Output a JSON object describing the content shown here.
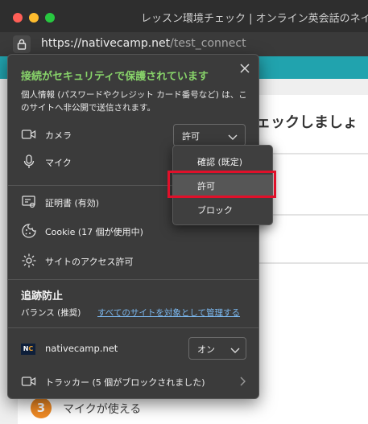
{
  "window": {
    "title": "レッスン環境チェック | オンライン英会話のネイティ"
  },
  "address_bar": {
    "url_host": "https://nativecamp.net",
    "url_path": "/test_connect"
  },
  "page": {
    "heading": "チェックしましょ",
    "step_number": "3",
    "step_text": "マイクが使える"
  },
  "panel": {
    "secure_title": "接続がセキュリティで保護されています",
    "secure_desc": "個人情報 (パスワードやクレジット カード番号など) は、このサイトへ非公開で送信されます。",
    "camera_label": "カメラ",
    "camera_value": "許可",
    "mic_label": "マイク",
    "certificate_label": "証明書 (有効)",
    "cookie_label": "Cookie (17 個が使用中)",
    "site_permissions_label": "サイトのアクセス許可",
    "tracking_title": "追跡防止",
    "balance_label": "バランス (推奨)",
    "manage_link": "すべてのサイトを対象として管理する",
    "site_name": "nativecamp.net",
    "site_toggle_value": "オン",
    "tracker_label": "トラッカー (5 個がブロックされました)"
  },
  "dropdown": {
    "options": [
      "確認 (既定)",
      "許可",
      "ブロック"
    ],
    "selected": "許可"
  },
  "colors": {
    "secure_green": "#88d46a",
    "link_blue": "#7bb7ee",
    "highlight_red": "#e0102a",
    "teal": "#21a3ae"
  }
}
